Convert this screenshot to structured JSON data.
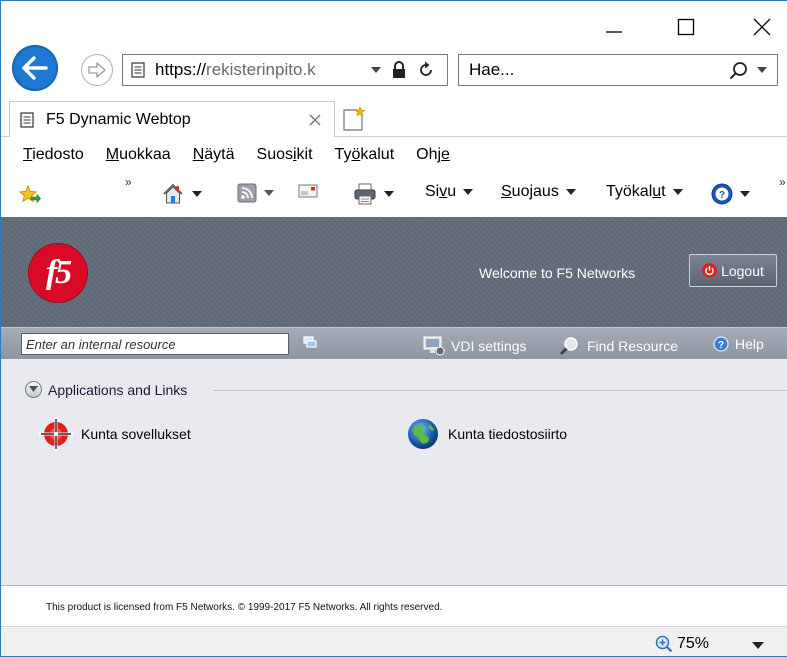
{
  "browser": {
    "address": {
      "scheme": "https://",
      "domain": "rekisterinpito.k"
    },
    "search": {
      "placeholder": "Hae..."
    },
    "tab": {
      "title": "F5 Dynamic Webtop"
    },
    "menu": [
      {
        "id": "file",
        "pre": "",
        "key": "T",
        "post": "iedosto"
      },
      {
        "id": "edit",
        "pre": "",
        "key": "M",
        "post": "uokkaa"
      },
      {
        "id": "view",
        "pre": "",
        "key": "N",
        "post": "äytä"
      },
      {
        "id": "favorites",
        "pre": "Suos",
        "key": "i",
        "post": "kit"
      },
      {
        "id": "tools",
        "pre": "Ty",
        "key": "ö",
        "post": "kalut"
      },
      {
        "id": "help",
        "pre": "Ohj",
        "key": "e",
        "post": ""
      }
    ],
    "commands": {
      "page": {
        "pre": "Si",
        "key": "v",
        "post": "u"
      },
      "safety": {
        "pre": "",
        "key": "S",
        "post": "uojaus"
      },
      "tools": {
        "pre": "Työkal",
        "key": "u",
        "post": "t"
      }
    },
    "chevron": "»",
    "zoom": "75%"
  },
  "webtop": {
    "logo_text": "f5",
    "welcome": "Welcome to F5 Networks",
    "logout_label": "Logout",
    "resource_placeholder": "Enter an internal resource",
    "toolbar": {
      "vdi": "VDI settings",
      "find": "Find Resource",
      "help": "Help"
    },
    "section_title": "Applications and Links",
    "apps": [
      {
        "label": "Kunta sovellukset"
      },
      {
        "label": "Kunta tiedostosiirto"
      }
    ],
    "footer": "This product is licensed from F5 Networks. © 1999-2017 F5 Networks. All rights reserved."
  },
  "colors": {
    "back_button": "#1f78d1",
    "f5_red": "#d80a25",
    "header_gray": "#66707d"
  }
}
